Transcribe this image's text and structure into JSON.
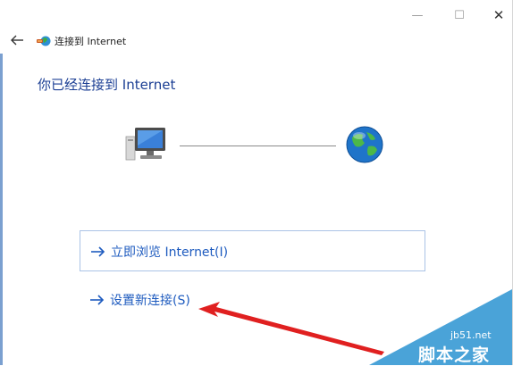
{
  "window": {
    "minimize_glyph": "—",
    "maximize_glyph": "☐",
    "close_glyph": "✕"
  },
  "nav": {
    "back_icon": "back-arrow-icon",
    "wizard_icon": "network-connect-icon",
    "title": "连接到 Internet"
  },
  "main": {
    "heading": "你已经连接到 Internet",
    "diagram": {
      "left_icon": "computer-monitor-icon",
      "right_icon": "globe-icon"
    },
    "options": [
      {
        "label": "立即浏览 Internet(I)",
        "icon": "arrow-right-icon"
      },
      {
        "label": "设置新连接(S)",
        "icon": "arrow-right-icon"
      }
    ]
  },
  "annotation": {
    "arrow_color": "#e02020"
  },
  "watermark": {
    "site": "jb51.net",
    "name": "脚本之家"
  },
  "colors": {
    "heading": "#1c3f94",
    "link": "#1e5bbf",
    "watermark_bg": "#4aa3d8"
  }
}
